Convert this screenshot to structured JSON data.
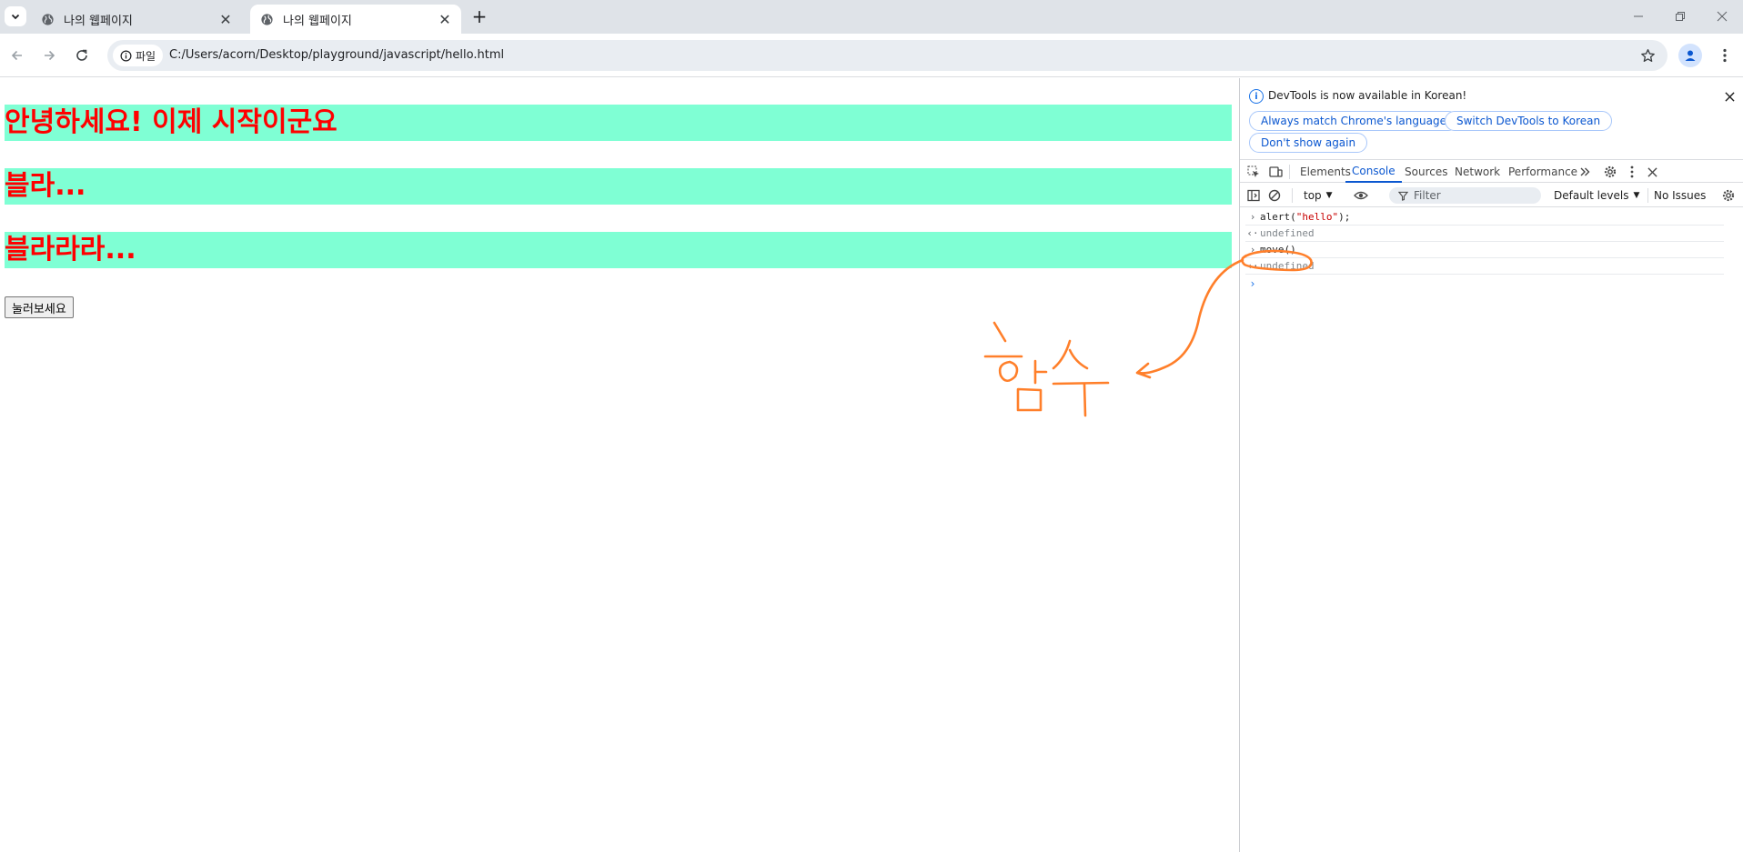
{
  "browser": {
    "tabs": [
      {
        "title": "나의 웹페이지",
        "active": false
      },
      {
        "title": "나의 웹페이지",
        "active": true
      }
    ],
    "new_tab_symbol": "+",
    "chip_label": "파일",
    "url": "C:/Users/acorn/Desktop/playground/javascript/hello.html"
  },
  "page": {
    "headings": [
      "안녕하세요! 이제 시작이군요",
      "블라...",
      "블라라라..."
    ],
    "button_label": "눌러보세요",
    "heading_bg": "#7fffd4",
    "heading_color": "#ff0000"
  },
  "annotation": {
    "color": "#ff7f2a"
  },
  "devtools": {
    "info_text": "DevTools is now available in Korean!",
    "pills": [
      "Always match Chrome's language",
      "Switch DevTools to Korean",
      "Don't show again"
    ],
    "tabs": [
      "Elements",
      "Console",
      "Sources",
      "Network",
      "Performance"
    ],
    "selected_tab": "Console",
    "context": "top",
    "filter_placeholder": "Filter",
    "levels": "Default levels",
    "issues": "No Issues",
    "console": [
      {
        "kind": "input",
        "text_prefix": "alert(",
        "string": "\"hello\"",
        "text_suffix": ");"
      },
      {
        "kind": "result",
        "text": "undefined"
      },
      {
        "kind": "input",
        "text": "move()"
      },
      {
        "kind": "result",
        "text": "undefined"
      }
    ]
  }
}
